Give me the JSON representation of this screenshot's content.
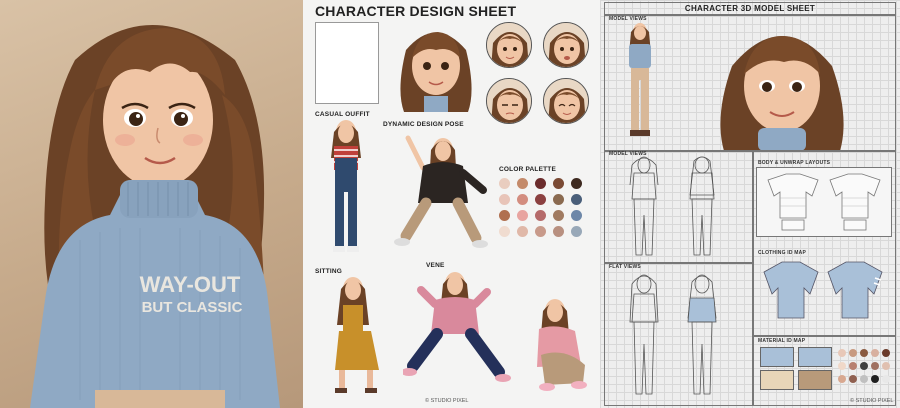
{
  "portrait": {
    "sweater_text_line1": "WAY-OUT",
    "sweater_text_line2": "BUT CLASSIC"
  },
  "sheet": {
    "title": "CHARACTER DESIGN SHEET",
    "labels": {
      "casual": "CASUAL OUFFIT",
      "dynamic": "DYNAMIC DESIGN POSE",
      "palette": "COLOR PALETTE",
      "sitting": "SITTING",
      "vene": "VENE"
    },
    "palette_colors": [
      "#e9cdbf",
      "#c48a6a",
      "#6b2c2c",
      "#7a4a34",
      "#3e2a20",
      "#e8c4b8",
      "#d38d7f",
      "#8b4040",
      "#8a6a50",
      "#4a5f7a",
      "#b07050",
      "#e8a4a0",
      "#b56a6a",
      "#a07a60",
      "#6d87a8",
      "#f0dcd0",
      "#e0b8a8",
      "#c89a8a",
      "#b89080",
      "#98a8b8"
    ],
    "footer": "© STUDIO PIXEL"
  },
  "model": {
    "title": "CHARACTER 3D MODEL SHEET",
    "labels": {
      "model_views_top": "MODEL VIEWS",
      "model_views_mid": "MODEL VIEWS",
      "body_unwrap": "BODY & UNWRAP LAYOUTS",
      "clothing_id": "CLOTHING ID MAP",
      "flat_views": "FLAT VIEWS",
      "material_id": "MATERIAL ID MAP"
    },
    "material_swatches": [
      "#e8c8b8",
      "#c89a80",
      "#8a5a40",
      "#d8b0a0",
      "#6a3a2a",
      "#f0d8c8",
      "#b88070",
      "#404040",
      "#a07060",
      "#e0c0b0",
      "#d8a890",
      "#906050",
      "#c0c0c0",
      "#202020",
      "#e8e8e8"
    ],
    "footer": "© STUDIO PIXEL"
  }
}
